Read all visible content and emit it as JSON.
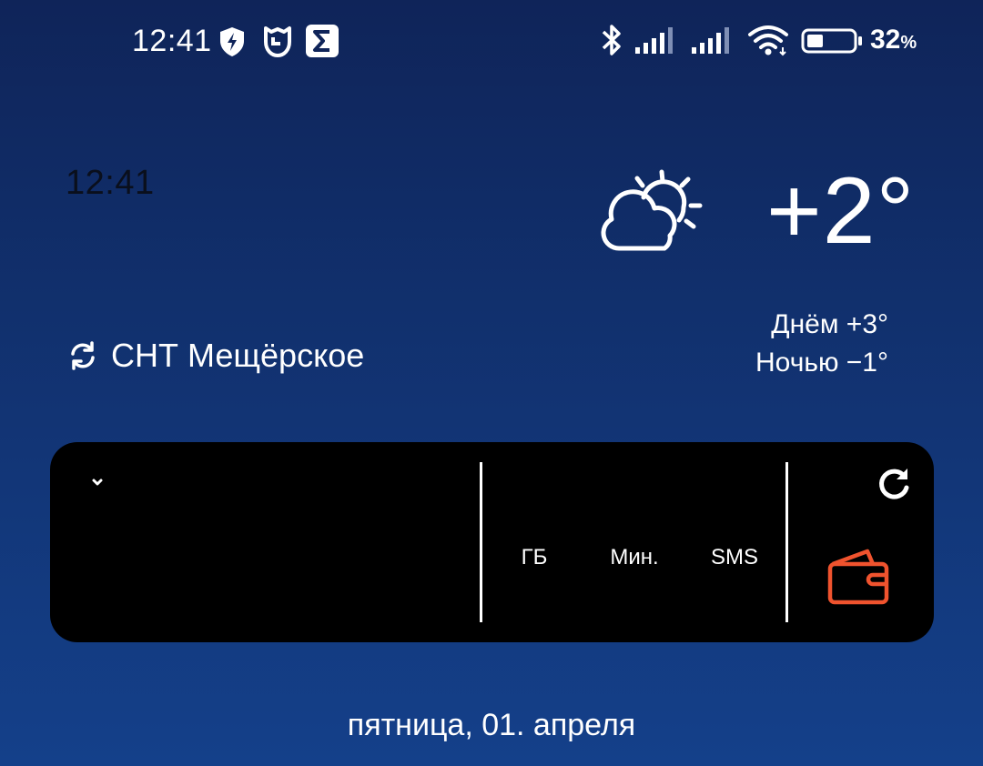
{
  "status_bar": {
    "time": "12:41",
    "battery_percent": "32",
    "battery_percent_sign": "%",
    "left_icons": [
      "shield-bolt-icon",
      "mi-home-icon",
      "sigma-icon"
    ],
    "right_icons": [
      "bluetooth-icon",
      "signal-sim1-icon",
      "signal-sim2-icon",
      "wifi-icon",
      "battery-icon"
    ],
    "battery_level": 0.32
  },
  "clock_widget": {
    "time": "12:41"
  },
  "weather": {
    "location": "СНТ Мещёрское",
    "icon": "partly-cloudy-icon",
    "temperature": "+2°",
    "day_forecast": "Днём +3°",
    "night_forecast": "Ночью −1°"
  },
  "operator_widget": {
    "units": {
      "gb": "ГБ",
      "minutes": "Мин.",
      "sms": "SMS"
    },
    "accent_color": "#f0532e"
  },
  "date": "пятница, 01. апреля"
}
